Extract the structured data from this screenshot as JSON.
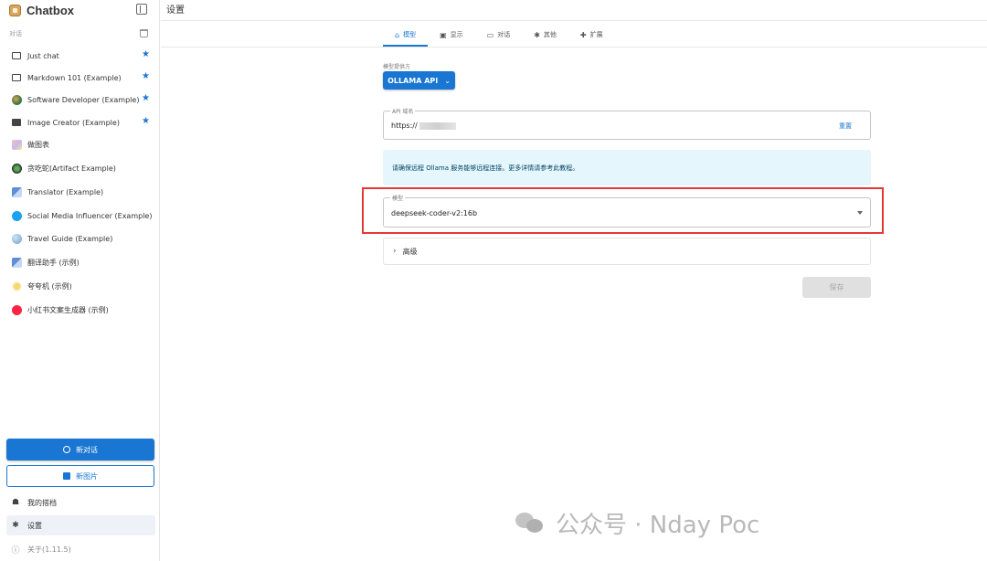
{
  "app": {
    "name": "Chatbox",
    "version_label": "关于(1.11.5)"
  },
  "sidebar": {
    "section_label": "对话",
    "sessions": [
      {
        "label": "Just chat",
        "icon": "chat-bubble-icon",
        "starred": true
      },
      {
        "label": "Markdown 101 (Example)",
        "icon": "chat-bubble-icon",
        "starred": true
      },
      {
        "label": "Software Developer (Example)",
        "icon": "developer-avatar-icon",
        "starred": true
      },
      {
        "label": "Image Creator (Example)",
        "icon": "image-icon",
        "starred": true
      },
      {
        "label": "做图表",
        "icon": "chart-avatar-icon",
        "starred": false
      },
      {
        "label": "贪吃蛇(Artifact Example)",
        "icon": "snake-avatar-icon",
        "starred": false
      },
      {
        "label": "Translator (Example)",
        "icon": "translator-avatar-icon",
        "starred": false
      },
      {
        "label": "Social Media Influencer (Example)",
        "icon": "twitter-avatar-icon",
        "starred": false
      },
      {
        "label": "Travel Guide (Example)",
        "icon": "globe-avatar-icon",
        "starred": false
      },
      {
        "label": "翻译助手 (示例)",
        "icon": "translator-avatar-icon",
        "starred": false
      },
      {
        "label": "夸夸机 (示例)",
        "icon": "praise-avatar-icon",
        "starred": false
      },
      {
        "label": "小红书文案生成器 (示例)",
        "icon": "xiaohongshu-avatar-icon",
        "starred": false
      }
    ],
    "star_glyph": "★",
    "new_chat_label": "新对话",
    "new_image_label": "新图片",
    "my_copilots_label": "我的搭档",
    "settings_label": "设置"
  },
  "main": {
    "title": "设置",
    "tabs": [
      {
        "label": "模型",
        "icon": "model-icon",
        "active": true
      },
      {
        "label": "显示",
        "icon": "display-icon",
        "active": false
      },
      {
        "label": "对话",
        "icon": "chat-icon",
        "active": false
      },
      {
        "label": "其他",
        "icon": "gear-icon",
        "active": false
      },
      {
        "label": "扩展",
        "icon": "puzzle-icon",
        "active": false
      }
    ],
    "provider_label": "模型提供方",
    "provider_value": "OLLAMA API",
    "api_field_label": "API 域名",
    "api_field_value": "https://",
    "reset_label": "重置",
    "info_text": "请确保远程 Ollama 服务能够远程连接。更多详情请参考此教程。",
    "model_field_label": "模型",
    "model_field_value": "deepseek-coder-v2:16b",
    "advanced_label": "高级",
    "save_label": "保存"
  },
  "watermark": {
    "text": "公众号 · Nday Poc"
  },
  "colors": {
    "accent": "#1976d2",
    "highlight": "#e53935",
    "info_bg": "#e5f6fd",
    "star": "#1976d2"
  }
}
